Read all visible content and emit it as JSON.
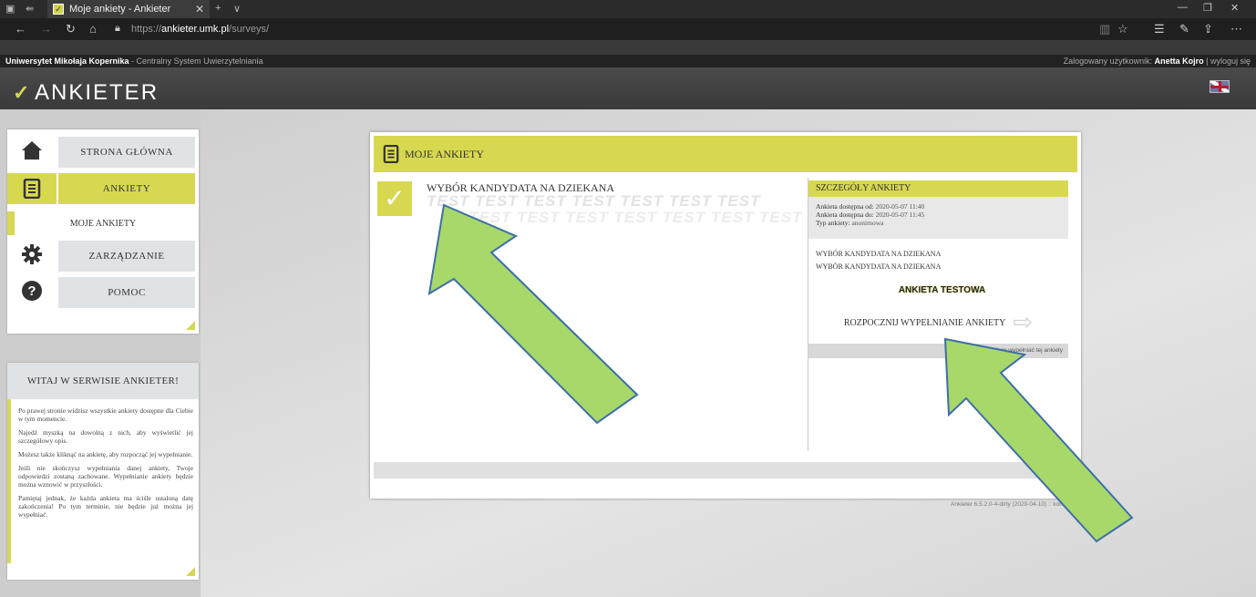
{
  "browser": {
    "tab_title": "Moje ankiety - Ankieter",
    "tab_close": "✕",
    "new_tab": "+",
    "tab_menu": "∨",
    "url_prefix": "https://",
    "url_host": "ankieter.umk.pl",
    "url_path": "/surveys/"
  },
  "unibar": {
    "university": "Uniwersytet Mikołaja Kopernika",
    "system": " - Centralny System Uwierzytelniania",
    "logged_label": "Zalogowany użytkownik: ",
    "user": "Anetta Kojro",
    "logout": "wyloguj się"
  },
  "header": {
    "logo_text": "ANKIETER"
  },
  "nav": {
    "items": [
      {
        "label": "STRONA GŁÓWNA",
        "icon": "home-icon"
      },
      {
        "label": "ANKIETY",
        "icon": "list-icon"
      },
      {
        "label": "ZARZĄDZANIE",
        "icon": "gear-icon"
      },
      {
        "label": "POMOC",
        "icon": "help-icon"
      }
    ],
    "sub_label": "MOJE ANKIETY"
  },
  "welcome": {
    "title": "WITAJ W SERWISIE ANKIETER!",
    "paragraphs": [
      "Po prawej stronie widzisz wszystkie ankiety dostępne dla Ciebie w tym momencie.",
      "Najedź myszką na dowolną z nich, aby wyświetlić jej szczegółowy opis.",
      "Możesz także kliknąć na ankietę, aby rozpocząć jej wypełnianie.",
      "Jeśli nie skończysz wypełniania danej ankiety, Twoje odpowiedzi zostaną zachowane. Wypełnianie ankiety będzie można wznowić w przyszłości.",
      "Pamiętaj jednak, że każda ankieta ma ściśle ustaloną datę zakończenia! Po tym terminie, nie będzie już można jej wypełniać."
    ]
  },
  "main": {
    "title": "MOJE ANKIETY",
    "survey_name": "WYBÓR KANDYDATA NA DZIEKANA",
    "watermark": "TEST TEST TEST TEST TEST TEST TEST",
    "details": {
      "title": "SZCZEGÓŁY ANKIETY",
      "from_label": "Ankieta dostępna od:",
      "from_value": "2020-05-07 11:40",
      "to_label": "Ankieta dostępna do:",
      "to_value": "2020-05-07 11:45",
      "type_label": "Typ ankiety:",
      "type_value": "anonimowa",
      "desc1": "WYBÓR KANDYDATA NA DZIEKANA",
      "desc2": "WYBÓR KANDYDATA NA DZIEKANA",
      "test_label": "ANKIETA TESTOWA",
      "start_label": "ROZPOCZNIJ WYPEŁNIANIE ANKIETY",
      "decline_label": "Nie chcę wypełniać tej ankiety"
    }
  },
  "footer": {
    "version": "Ankieter 6.5.2.0-4-dirty (2020-04-10) :: kontakt"
  },
  "colors": {
    "accent": "#d7d850",
    "annotation_arrow_fill": "#a8d86a",
    "annotation_arrow_stroke": "#3e6ea8"
  }
}
